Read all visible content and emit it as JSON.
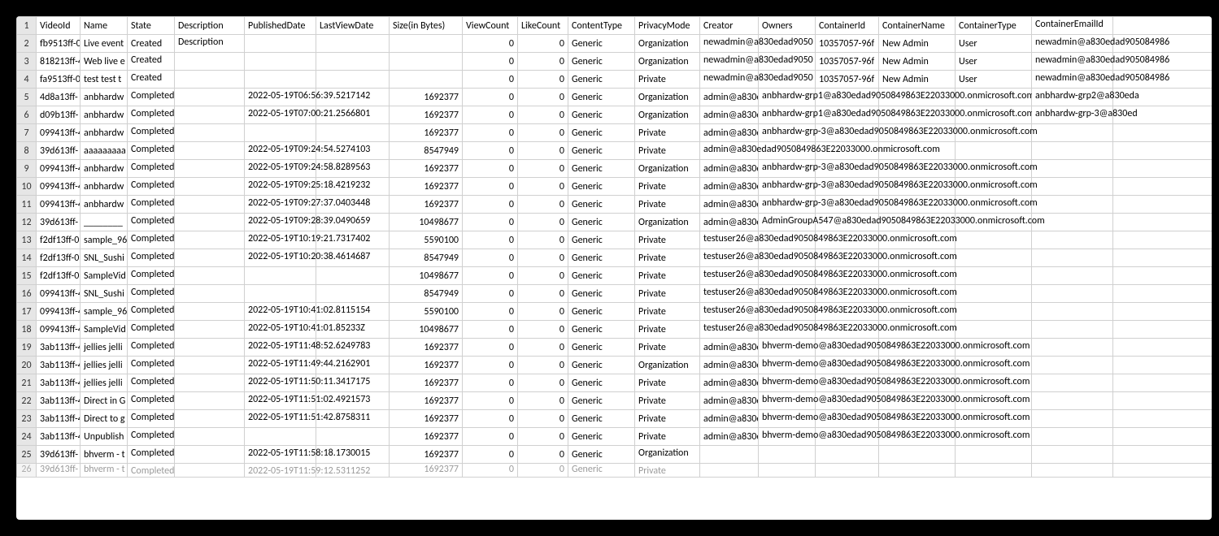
{
  "headers": {
    "videoId": "VideoId",
    "name": "Name",
    "state": "State",
    "description": "Description",
    "publishedDate": "PublishedDate",
    "lastViewDate": "LastViewDate",
    "size": "Size(in Bytes)",
    "viewCount": "ViewCount",
    "likeCount": "LikeCount",
    "contentType": "ContentType",
    "privacyMode": "PrivacyMode",
    "creator": "Creator",
    "owners": "Owners",
    "containerId": "ContainerId",
    "containerName": "ContainerName",
    "containerType": "ContainerType",
    "containerEmailId": "ContainerEmailId"
  },
  "rows": [
    {
      "rownum": "1"
    },
    {
      "rownum": "2",
      "videoId": "fb9513ff-0",
      "name": "Live event",
      "state": "Created",
      "description": "Description",
      "publishedDate": "",
      "lastViewDate": "",
      "size": "",
      "viewCount": "0",
      "likeCount": "0",
      "contentType": "Generic",
      "privacyMode": "Organization",
      "creator": "newadmin@a830edad9050",
      "owners": "",
      "containerId": "10357057-96f",
      "containerName": "New Admin",
      "containerType": "User",
      "containerEmailId": "newadmin@a830edad905084986"
    },
    {
      "rownum": "3",
      "videoId": "818213ff-4",
      "name": "Web live e",
      "state": "Created",
      "description": "",
      "publishedDate": "",
      "lastViewDate": "",
      "size": "",
      "viewCount": "0",
      "likeCount": "0",
      "contentType": "Generic",
      "privacyMode": "Organization",
      "creator": "newadmin@a830edad9050",
      "owners": "",
      "containerId": "10357057-96f",
      "containerName": "New Admin",
      "containerType": "User",
      "containerEmailId": "newadmin@a830edad905084986"
    },
    {
      "rownum": "4",
      "videoId": "fa9513ff-0",
      "name": "test test t",
      "state": "Created",
      "description": "",
      "publishedDate": "",
      "lastViewDate": "",
      "size": "",
      "viewCount": "0",
      "likeCount": "0",
      "contentType": "Generic",
      "privacyMode": "Private",
      "creator": "newadmin@a830edad9050",
      "owners": "",
      "containerId": "10357057-96f",
      "containerName": "New Admin",
      "containerType": "User",
      "containerEmailId": "newadmin@a830edad905084986"
    },
    {
      "rownum": "5",
      "videoId": "4d8a13ff-",
      "name": "anbhardw",
      "state": "Completed",
      "description": "",
      "publishedDate": "2022-05-19T06:56:39.5217142",
      "lastViewDate": "",
      "size": "1692377",
      "viewCount": "0",
      "likeCount": "0",
      "contentType": "Generic",
      "privacyMode": "Organization",
      "creator": "admin@a830e",
      "owners": "anbhardw-grp1@a830edad9050849863E22033000.onmicrosoft.com",
      "containerId": "",
      "containerName": "",
      "containerType": "",
      "containerEmailId": "anbhardw-grp2@a830eda"
    },
    {
      "rownum": "6",
      "videoId": "d09b13ff-",
      "name": "anbhardw",
      "state": "Completed",
      "description": "",
      "publishedDate": "2022-05-19T07:00:21.2566801",
      "lastViewDate": "",
      "size": "1692377",
      "viewCount": "0",
      "likeCount": "0",
      "contentType": "Generic",
      "privacyMode": "Organization",
      "creator": "admin@a830e",
      "owners": "anbhardw-grp1@a830edad9050849863E22033000.onmicrosoft.com",
      "containerId": "",
      "containerName": "",
      "containerType": "",
      "containerEmailId": "anbhardw-grp-3@a830ed"
    },
    {
      "rownum": "7",
      "videoId": "099413ff-4",
      "name": "anbhardw",
      "state": "Completed",
      "description": "",
      "publishedDate": "",
      "lastViewDate": "",
      "size": "1692377",
      "viewCount": "0",
      "likeCount": "0",
      "contentType": "Generic",
      "privacyMode": "Private",
      "creator": "admin@a830e",
      "owners": "anbhardw-grp-3@a830edad9050849863E22033000.onmicrosoft.com",
      "containerId": "",
      "containerName": "",
      "containerType": "",
      "containerEmailId": ""
    },
    {
      "rownum": "8",
      "videoId": "39d613ff-",
      "name": "aaaaaaaaa",
      "state": "Completed",
      "description": "",
      "publishedDate": "2022-05-19T09:24:54.5274103",
      "lastViewDate": "",
      "size": "8547949",
      "viewCount": "0",
      "likeCount": "0",
      "contentType": "Generic",
      "privacyMode": "Private",
      "creator": "admin@a830edad9050849863E22033000.onmicrosoft.com",
      "owners": "",
      "containerId": "",
      "containerName": "",
      "containerType": "",
      "containerEmailId": ""
    },
    {
      "rownum": "9",
      "videoId": "099413ff-4",
      "name": "anbhardw",
      "state": "Completed",
      "description": "",
      "publishedDate": "2022-05-19T09:24:58.8289563",
      "lastViewDate": "",
      "size": "1692377",
      "viewCount": "0",
      "likeCount": "0",
      "contentType": "Generic",
      "privacyMode": "Organization",
      "creator": "admin@a830e",
      "owners": "anbhardw-grp-3@a830edad9050849863E22033000.onmicrosoft.com",
      "containerId": "",
      "containerName": "",
      "containerType": "",
      "containerEmailId": ""
    },
    {
      "rownum": "10",
      "videoId": "099413ff-4",
      "name": "anbhardw",
      "state": "Completed",
      "description": "",
      "publishedDate": "2022-05-19T09:25:18.4219232",
      "lastViewDate": "",
      "size": "1692377",
      "viewCount": "0",
      "likeCount": "0",
      "contentType": "Generic",
      "privacyMode": "Private",
      "creator": "admin@a830e",
      "owners": "anbhardw-grp-3@a830edad9050849863E22033000.onmicrosoft.com",
      "containerId": "",
      "containerName": "",
      "containerType": "",
      "containerEmailId": ""
    },
    {
      "rownum": "11",
      "videoId": "099413ff-4",
      "name": "anbhardw",
      "state": "Completed",
      "description": "",
      "publishedDate": "2022-05-19T09:27:37.0403448",
      "lastViewDate": "",
      "size": "1692377",
      "viewCount": "0",
      "likeCount": "0",
      "contentType": "Generic",
      "privacyMode": "Private",
      "creator": "admin@a830e",
      "owners": "anbhardw-grp-3@a830edad9050849863E22033000.onmicrosoft.com",
      "containerId": "",
      "containerName": "",
      "containerType": "",
      "containerEmailId": ""
    },
    {
      "rownum": "12",
      "videoId": "39d613ff-",
      "name": "________",
      "state": "Completed",
      "description": "",
      "publishedDate": "2022-05-19T09:28:39.0490659",
      "lastViewDate": "",
      "size": "10498677",
      "viewCount": "0",
      "likeCount": "0",
      "contentType": "Generic",
      "privacyMode": "Organization",
      "creator": "admin@a830e",
      "owners": "AdminGroupA547@a830edad9050849863E22033000.onmicrosoft.com",
      "containerId": "",
      "containerName": "",
      "containerType": "",
      "containerEmailId": ""
    },
    {
      "rownum": "13",
      "videoId": "f2df13ff-0",
      "name": "sample_96",
      "state": "Completed",
      "description": "",
      "publishedDate": "2022-05-19T10:19:21.7317402",
      "lastViewDate": "",
      "size": "5590100",
      "viewCount": "0",
      "likeCount": "0",
      "contentType": "Generic",
      "privacyMode": "Private",
      "creator": "testuser26@a830edad9050849863E22033000.onmicrosoft.com",
      "owners": "",
      "containerId": "",
      "containerName": "",
      "containerType": "",
      "containerEmailId": ""
    },
    {
      "rownum": "14",
      "videoId": "f2df13ff-0",
      "name": "SNL_Sushi",
      "state": "Completed",
      "description": "",
      "publishedDate": "2022-05-19T10:20:38.4614687",
      "lastViewDate": "",
      "size": "8547949",
      "viewCount": "0",
      "likeCount": "0",
      "contentType": "Generic",
      "privacyMode": "Private",
      "creator": "testuser26@a830edad9050849863E22033000.onmicrosoft.com",
      "owners": "",
      "containerId": "",
      "containerName": "",
      "containerType": "",
      "containerEmailId": ""
    },
    {
      "rownum": "15",
      "videoId": "f2df13ff-0",
      "name": "SampleVid",
      "state": "Completed",
      "description": "",
      "publishedDate": "",
      "lastViewDate": "",
      "size": "10498677",
      "viewCount": "0",
      "likeCount": "0",
      "contentType": "Generic",
      "privacyMode": "Private",
      "creator": "testuser26@a830edad9050849863E22033000.onmicrosoft.com",
      "owners": "",
      "containerId": "",
      "containerName": "",
      "containerType": "",
      "containerEmailId": ""
    },
    {
      "rownum": "16",
      "videoId": "099413ff-4",
      "name": "SNL_Sushi",
      "state": "Completed",
      "description": "",
      "publishedDate": "",
      "lastViewDate": "",
      "size": "8547949",
      "viewCount": "0",
      "likeCount": "0",
      "contentType": "Generic",
      "privacyMode": "Private",
      "creator": "testuser26@a830edad9050849863E22033000.onmicrosoft.com",
      "owners": "",
      "containerId": "",
      "containerName": "",
      "containerType": "",
      "containerEmailId": ""
    },
    {
      "rownum": "17",
      "videoId": "099413ff-4",
      "name": "sample_96",
      "state": "Completed",
      "description": "",
      "publishedDate": "2022-05-19T10:41:02.8115154",
      "lastViewDate": "",
      "size": "5590100",
      "viewCount": "0",
      "likeCount": "0",
      "contentType": "Generic",
      "privacyMode": "Private",
      "creator": "testuser26@a830edad9050849863E22033000.onmicrosoft.com",
      "owners": "",
      "containerId": "",
      "containerName": "",
      "containerType": "",
      "containerEmailId": ""
    },
    {
      "rownum": "18",
      "videoId": "099413ff-4",
      "name": "SampleVid",
      "state": "Completed",
      "description": "",
      "publishedDate": "2022-05-19T10:41:01.85233Z",
      "lastViewDate": "",
      "size": "10498677",
      "viewCount": "0",
      "likeCount": "0",
      "contentType": "Generic",
      "privacyMode": "Private",
      "creator": "testuser26@a830edad9050849863E22033000.onmicrosoft.com",
      "owners": "",
      "containerId": "",
      "containerName": "",
      "containerType": "",
      "containerEmailId": ""
    },
    {
      "rownum": "19",
      "videoId": "3ab113ff-4",
      "name": "jellies jelli",
      "state": "Completed",
      "description": "",
      "publishedDate": "2022-05-19T11:48:52.6249783",
      "lastViewDate": "",
      "size": "1692377",
      "viewCount": "0",
      "likeCount": "0",
      "contentType": "Generic",
      "privacyMode": "Private",
      "creator": "admin@a830e",
      "owners": "bhverm-demo@a830edad9050849863E22033000.onmicrosoft.com",
      "containerId": "",
      "containerName": "",
      "containerType": "",
      "containerEmailId": ""
    },
    {
      "rownum": "20",
      "videoId": "3ab113ff-4",
      "name": "jellies jelli",
      "state": "Completed",
      "description": "",
      "publishedDate": "2022-05-19T11:49:44.2162901",
      "lastViewDate": "",
      "size": "1692377",
      "viewCount": "0",
      "likeCount": "0",
      "contentType": "Generic",
      "privacyMode": "Organization",
      "creator": "admin@a830e",
      "owners": "bhverm-demo@a830edad9050849863E22033000.onmicrosoft.com",
      "containerId": "",
      "containerName": "",
      "containerType": "",
      "containerEmailId": ""
    },
    {
      "rownum": "21",
      "videoId": "3ab113ff-4",
      "name": "jellies jelli",
      "state": "Completed",
      "description": "",
      "publishedDate": "2022-05-19T11:50:11.3417175",
      "lastViewDate": "",
      "size": "1692377",
      "viewCount": "0",
      "likeCount": "0",
      "contentType": "Generic",
      "privacyMode": "Private",
      "creator": "admin@a830e",
      "owners": "bhverm-demo@a830edad9050849863E22033000.onmicrosoft.com",
      "containerId": "",
      "containerName": "",
      "containerType": "",
      "containerEmailId": ""
    },
    {
      "rownum": "22",
      "videoId": "3ab113ff-4",
      "name": "Direct in G",
      "state": "Completed",
      "description": "",
      "publishedDate": "2022-05-19T11:51:02.4921573",
      "lastViewDate": "",
      "size": "1692377",
      "viewCount": "0",
      "likeCount": "0",
      "contentType": "Generic",
      "privacyMode": "Private",
      "creator": "admin@a830e",
      "owners": "bhverm-demo@a830edad9050849863E22033000.onmicrosoft.com",
      "containerId": "",
      "containerName": "",
      "containerType": "",
      "containerEmailId": ""
    },
    {
      "rownum": "23",
      "videoId": "3ab113ff-4",
      "name": "Direct to g",
      "state": "Completed",
      "description": "",
      "publishedDate": "2022-05-19T11:51:42.8758311",
      "lastViewDate": "",
      "size": "1692377",
      "viewCount": "0",
      "likeCount": "0",
      "contentType": "Generic",
      "privacyMode": "Private",
      "creator": "admin@a830e",
      "owners": "bhverm-demo@a830edad9050849863E22033000.onmicrosoft.com",
      "containerId": "",
      "containerName": "",
      "containerType": "",
      "containerEmailId": ""
    },
    {
      "rownum": "24",
      "videoId": "3ab113ff-4",
      "name": "Unpublish",
      "state": "Completed",
      "description": "",
      "publishedDate": "",
      "lastViewDate": "",
      "size": "1692377",
      "viewCount": "0",
      "likeCount": "0",
      "contentType": "Generic",
      "privacyMode": "Private",
      "creator": "admin@a830e",
      "owners": "bhverm-demo@a830edad9050849863E22033000.onmicrosoft.com",
      "containerId": "",
      "containerName": "",
      "containerType": "",
      "containerEmailId": ""
    },
    {
      "rownum": "25",
      "videoId": "39d613ff-",
      "name": "bhverm - t",
      "state": "Completed",
      "description": "",
      "publishedDate": "2022-05-19T11:58:18.1730015",
      "lastViewDate": "",
      "size": "1692377",
      "viewCount": "0",
      "likeCount": "0",
      "contentType": "Generic",
      "privacyMode": "Organization",
      "creator": "",
      "owners": "",
      "containerId": "",
      "containerName": "",
      "containerType": "",
      "containerEmailId": ""
    }
  ],
  "partialRow": {
    "rownum": "26",
    "videoId": "39d613ff-",
    "name": "bhverm - t",
    "state": "Completed",
    "description": "",
    "publishedDate": "2022-05-19T11:59:12.5311252",
    "lastViewDate": "",
    "size": "1692377",
    "viewCount": "0",
    "likeCount": "0",
    "contentType": "Generic",
    "privacyMode": "Private",
    "creator": "",
    "owners": "",
    "containerId": "",
    "containerName": "",
    "containerType": "",
    "containerEmailId": ""
  }
}
